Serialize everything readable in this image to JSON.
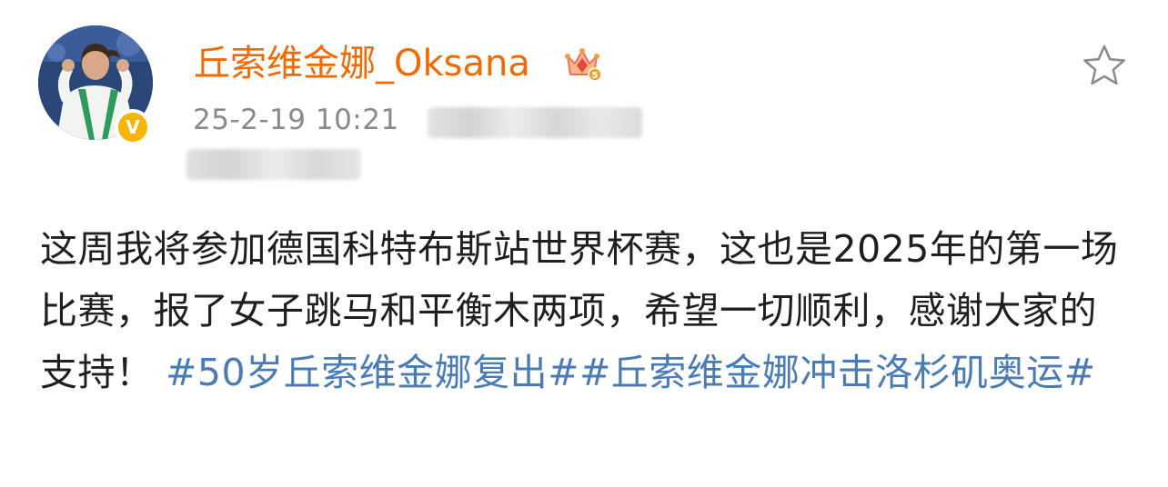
{
  "user": {
    "name": "丘索维金娜_Oksana",
    "verified_badge": "V",
    "avatar_icon": "avatar-photo",
    "membership_icon": "crown-icon"
  },
  "meta": {
    "time": "25-2-19 10:21"
  },
  "post": {
    "text": "这周我将参加德国科特布斯站世界杯赛，这也是2025年的第一场比赛，报了女子跳马和平衡木两项，希望一切顺利，感谢大家的支持！",
    "hashtags": [
      "#50岁丘索维金娜复出#",
      "#丘索维金娜冲击洛杉矶奥运#"
    ]
  },
  "actions": {
    "favorite_icon": "star-icon"
  },
  "colors": {
    "username": "#f06a00",
    "hashtag": "#4a7bb5",
    "meta": "#8a8a8a",
    "badge": "#f7b500",
    "text": "#1f1f1f"
  }
}
